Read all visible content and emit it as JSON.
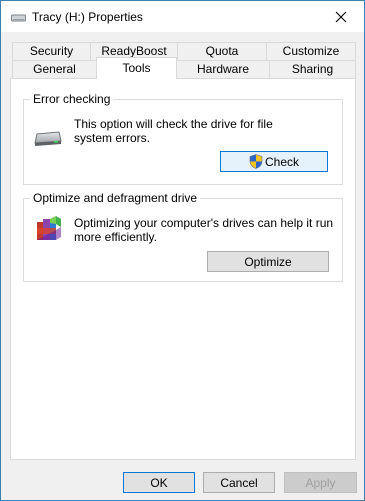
{
  "window": {
    "title": "Tracy (H:) Properties"
  },
  "tabs_row1": [
    {
      "label": "Security"
    },
    {
      "label": "ReadyBoost"
    },
    {
      "label": "Quota"
    },
    {
      "label": "Customize"
    }
  ],
  "tabs_row2": [
    {
      "label": "General"
    },
    {
      "label": "Tools",
      "active": true
    },
    {
      "label": "Hardware"
    },
    {
      "label": "Sharing"
    }
  ],
  "error_checking": {
    "title": "Error checking",
    "description_line1": "This option will check the drive for file",
    "description_line2": "system errors.",
    "button_label": "Check",
    "icon": "drive-icon"
  },
  "optimize": {
    "title": "Optimize and defragment drive",
    "description_line1": "Optimizing your computer's drives can help it run",
    "description_line2": "more efficiently.",
    "button_label": "Optimize",
    "icon": "defrag-icon"
  },
  "footer": {
    "ok_label": "OK",
    "cancel_label": "Cancel",
    "apply_label": "Apply"
  },
  "colors": {
    "accent": "#0078d7",
    "window_border": "#3c7fb1"
  }
}
